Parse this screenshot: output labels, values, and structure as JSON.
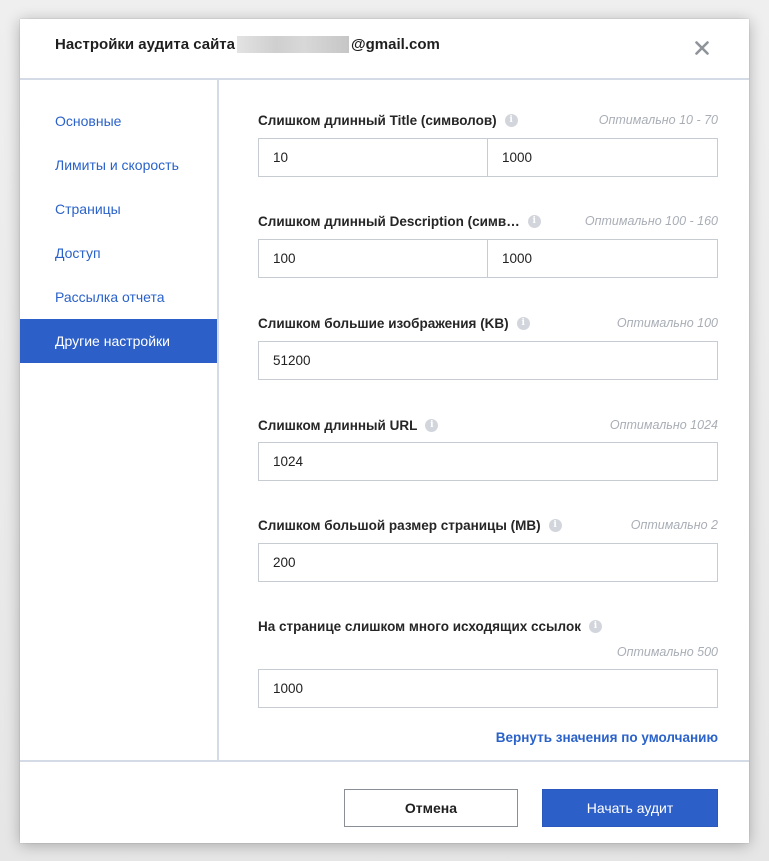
{
  "dialog": {
    "title_prefix": "Настройки аудита сайта",
    "title_suffix": "@gmail.com"
  },
  "sidebar": {
    "items": [
      {
        "label": "Основные",
        "active": false
      },
      {
        "label": "Лимиты и скорость",
        "active": false
      },
      {
        "label": "Страницы",
        "active": false
      },
      {
        "label": "Доступ",
        "active": false
      },
      {
        "label": "Рассылка отчета",
        "active": false
      },
      {
        "label": "Другие настройки",
        "active": true
      }
    ]
  },
  "fields": [
    {
      "label": "Слишком длинный Title (символов)",
      "hint": "Оптимально 10 - 70",
      "values": [
        "10",
        "1000"
      ]
    },
    {
      "label": "Слишком длинный Description (симв…",
      "hint": "Оптимально 100 - 160",
      "values": [
        "100",
        "1000"
      ]
    },
    {
      "label": "Слишком большие изображения (KB)",
      "hint": "Оптимально 100",
      "values": [
        "51200"
      ]
    },
    {
      "label": "Слишком длинный URL",
      "hint": "Оптимально 1024",
      "values": [
        "1024"
      ]
    },
    {
      "label": "Слишком большой размер страницы (MB)",
      "hint": "Оптимально 2",
      "values": [
        "200"
      ]
    },
    {
      "label": "На странице слишком много исходящих ссылок",
      "hint": "Оптимально 500",
      "values": [
        "1000"
      ]
    }
  ],
  "reset_label": "Вернуть значения по умолчанию",
  "footer": {
    "cancel_label": "Отмена",
    "start_label": "Начать аудит"
  },
  "colors": {
    "accent": "#2d5fc8",
    "link": "#2a62c9",
    "hint": "#a9aeb6"
  },
  "icons": {
    "close": "close-icon",
    "info": "info-icon"
  }
}
